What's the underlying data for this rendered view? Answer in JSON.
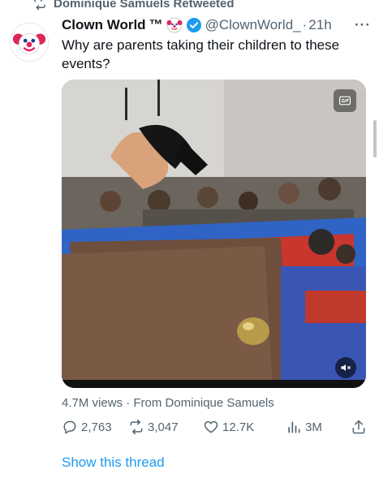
{
  "retweet_banner": "Dominique Samuels Retweeted",
  "tweet": {
    "display_name": "Clown World",
    "trademark": "™",
    "handle": "@ClownWorld_",
    "dot": "·",
    "time": "21h",
    "more": "···",
    "text": "Why are parents taking their children to these events?"
  },
  "media": {
    "gif_label": "GIF",
    "mute_icon": "speaker-muted-icon"
  },
  "meta": {
    "views": "4.7M views",
    "separator": " · ",
    "from": "From Dominique Samuels"
  },
  "actions": {
    "replies": "2,763",
    "retweets": "3,047",
    "likes": "12.7K",
    "views": "3M"
  },
  "show_thread": "Show this thread",
  "colors": {
    "accent": "#1d9bf0",
    "secondary_text": "#536471",
    "verified": "#1d9bf0"
  }
}
